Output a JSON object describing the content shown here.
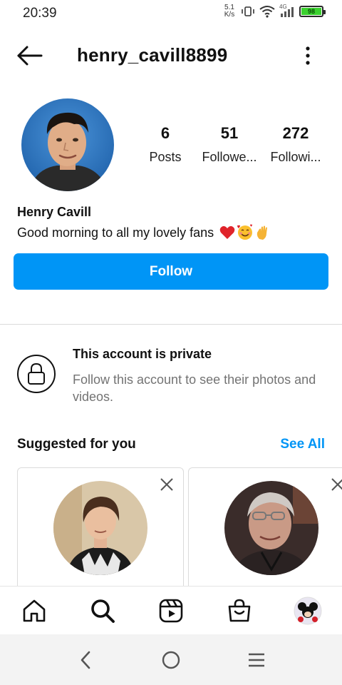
{
  "status_bar": {
    "time": "20:39",
    "net_speed_value": "5.1",
    "net_speed_unit": "K/s",
    "network_type": "4G",
    "battery_level": "98",
    "icons": [
      "vibrate-icon",
      "wifi-icon",
      "signal-icon",
      "battery-icon"
    ]
  },
  "header": {
    "username": "henry_cavill8899",
    "back_icon": "arrow-left-icon",
    "more_icon": "more-vertical-icon"
  },
  "profile": {
    "stats": [
      {
        "value": "6",
        "label": "Posts"
      },
      {
        "value": "51",
        "label": "Followe..."
      },
      {
        "value": "272",
        "label": "Followi..."
      }
    ],
    "name": "Henry Cavill",
    "bio": "Good morning to all my lovely fans",
    "bio_emojis": [
      "heart-emoji",
      "smiling-face-with-hearts-emoji",
      "waving-hand-emoji"
    ],
    "follow_label": "Follow"
  },
  "private_notice": {
    "title": "This account is private",
    "description": "Follow this account to see their photos and videos."
  },
  "suggested": {
    "title": "Suggested for you",
    "see_all": "See All"
  },
  "bottom_nav": [
    "home-icon",
    "search-icon",
    "reels-icon",
    "shop-icon",
    "profile-avatar"
  ],
  "colors": {
    "accent": "#0095f6",
    "muted_text": "#737373",
    "divider": "#dbdbdb"
  }
}
